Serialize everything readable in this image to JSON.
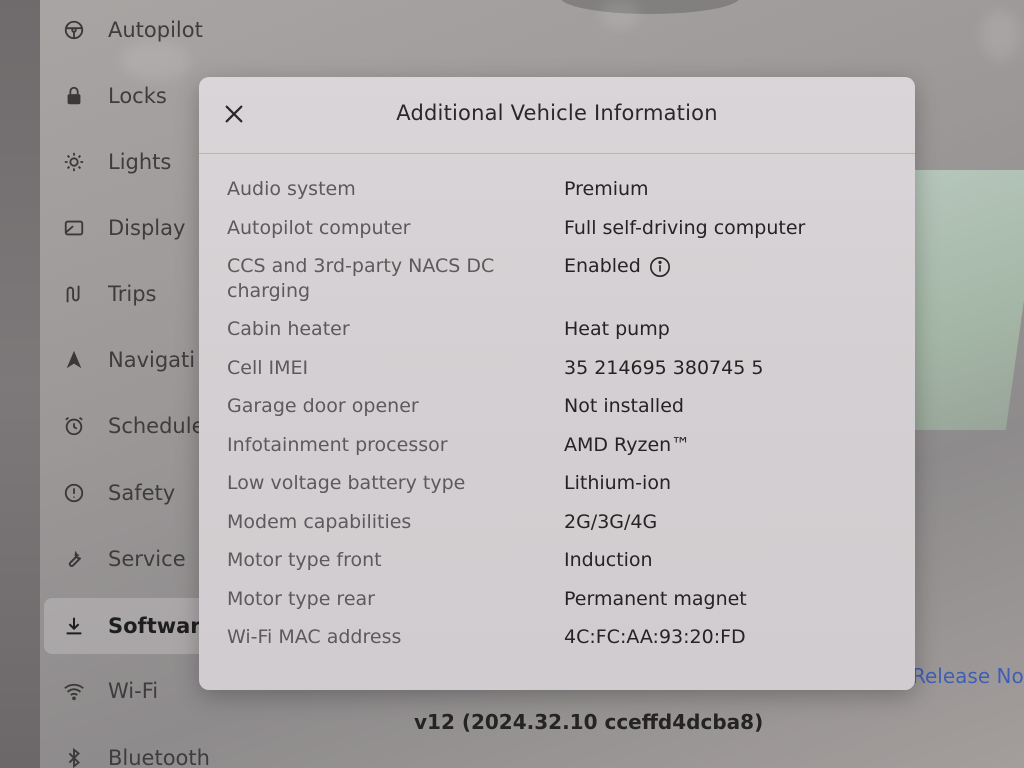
{
  "sidebar": {
    "items": [
      {
        "label": "Autopilot",
        "icon": "steering-wheel-icon"
      },
      {
        "label": "Locks",
        "icon": "lock-icon"
      },
      {
        "label": "Lights",
        "icon": "sun-icon"
      },
      {
        "label": "Display",
        "icon": "display-icon"
      },
      {
        "label": "Trips",
        "icon": "route-icon"
      },
      {
        "label": "Navigati",
        "icon": "navigation-icon"
      },
      {
        "label": "Schedule",
        "icon": "alarm-clock-icon"
      },
      {
        "label": "Safety",
        "icon": "alert-circle-icon"
      },
      {
        "label": "Service",
        "icon": "wrench-icon"
      },
      {
        "label": "Software",
        "icon": "download-icon",
        "active": true
      },
      {
        "label": "Wi-Fi",
        "icon": "wifi-icon"
      },
      {
        "label": "Bluetooth",
        "icon": "bluetooth-icon"
      }
    ]
  },
  "software": {
    "release_notes_link": "Release No",
    "version": "v12 (2024.32.10 cceffd4dcba8)"
  },
  "modal": {
    "title": "Additional Vehicle Information",
    "close_icon": "close-icon",
    "rows": [
      {
        "label": "Audio system",
        "value": "Premium"
      },
      {
        "label": "Autopilot computer",
        "value": "Full self-driving computer"
      },
      {
        "label": "CCS and 3rd-party NACS DC charging",
        "value": "Enabled",
        "info": true
      },
      {
        "label": "Cabin heater",
        "value": "Heat pump"
      },
      {
        "label": "Cell IMEI",
        "value": "35 214695 380745 5"
      },
      {
        "label": "Garage door opener",
        "value": "Not installed"
      },
      {
        "label": "Infotainment processor",
        "value": "AMD Ryzen™"
      },
      {
        "label": "Low voltage battery type",
        "value": "Lithium-ion"
      },
      {
        "label": "Modem capabilities",
        "value": "2G/3G/4G"
      },
      {
        "label": "Motor type front",
        "value": "Induction"
      },
      {
        "label": "Motor type rear",
        "value": "Permanent magnet"
      },
      {
        "label": "Wi-Fi MAC address",
        "value": "4C:FC:AA:93:20:FD"
      }
    ]
  },
  "colors": {
    "link": "#3f5fb5",
    "modal_bg": "#d5d1d4",
    "label_text": "#5c5a5c",
    "value_text": "#252425"
  }
}
